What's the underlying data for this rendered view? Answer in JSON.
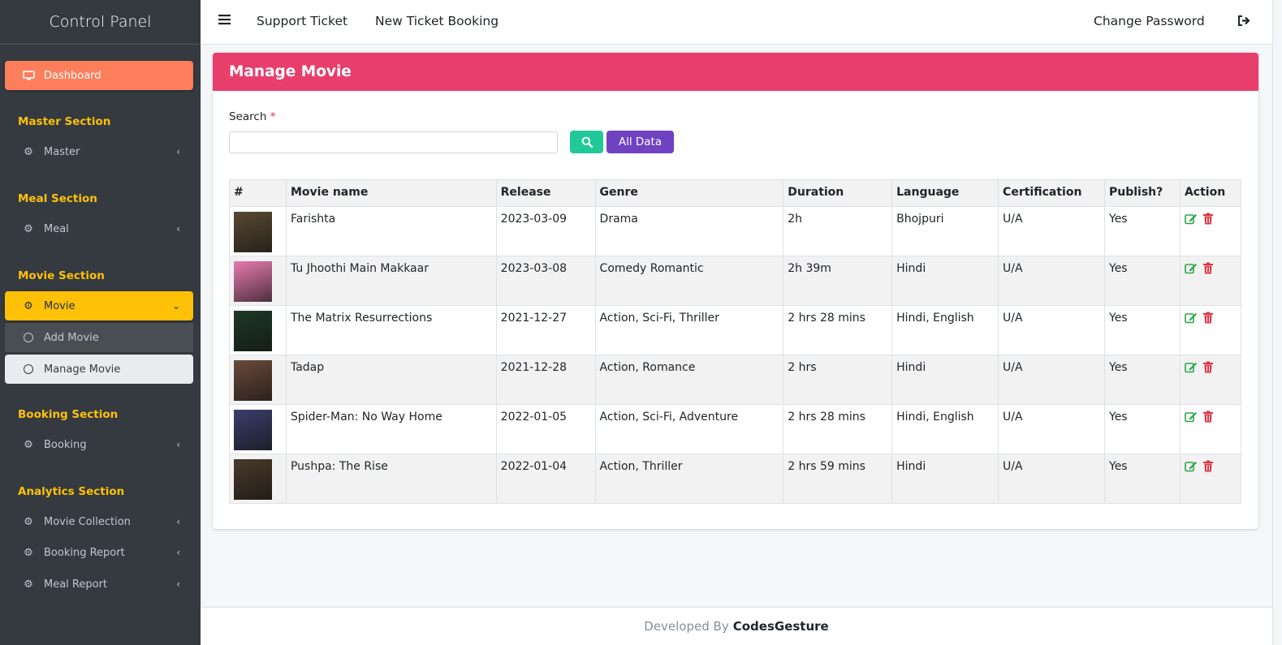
{
  "brand": "Control Panel",
  "sidebar": {
    "dashboard": "Dashboard",
    "sections": {
      "master": {
        "title": "Master Section",
        "item": "Master"
      },
      "meal": {
        "title": "Meal Section",
        "item": "Meal"
      },
      "movie": {
        "title": "Movie Section",
        "item": "Movie",
        "sub": [
          "Add Movie",
          "Manage Movie"
        ]
      },
      "booking": {
        "title": "Booking Section",
        "item": "Booking"
      },
      "analytics": {
        "title": "Analytics Section",
        "items": [
          "Movie Collection",
          "Booking Report",
          "Meal Report"
        ]
      }
    }
  },
  "topbar": {
    "support": "Support Ticket",
    "new_booking": "New Ticket Booking",
    "change_password": "Change Password"
  },
  "card": {
    "title": "Manage Movie",
    "search_label": "Search",
    "required_mark": "*",
    "search_value": "",
    "all_data_label": "All Data"
  },
  "table": {
    "headers": [
      "#",
      "Movie name",
      "Release",
      "Genre",
      "Duration",
      "Language",
      "Certification",
      "Publish?",
      "Action"
    ],
    "rows": [
      {
        "name": "Farishta",
        "release": "2023-03-09",
        "genre": "Drama",
        "duration": "2h",
        "language": "Bhojpuri",
        "cert": "U/A",
        "publish": "Yes",
        "poster_color": "#5a4a32"
      },
      {
        "name": "Tu Jhoothi Main Makkaar",
        "release": "2023-03-08",
        "genre": "Comedy Romantic",
        "duration": "2h 39m",
        "language": "Hindi",
        "cert": "U/A",
        "publish": "Yes",
        "poster_color": "#e87bb0"
      },
      {
        "name": "The Matrix Resurrections",
        "release": "2021-12-27",
        "genre": "Action, Sci-Fi, Thriller",
        "duration": "2 hrs 28 mins",
        "language": "Hindi, English",
        "cert": "U/A",
        "publish": "Yes",
        "poster_color": "#1e3a24"
      },
      {
        "name": "Tadap",
        "release": "2021-12-28",
        "genre": "Action, Romance",
        "duration": "2 hrs",
        "language": "Hindi",
        "cert": "U/A",
        "publish": "Yes",
        "poster_color": "#6b4a3a"
      },
      {
        "name": "Spider-Man: No Way Home",
        "release": "2022-01-05",
        "genre": "Action, Sci-Fi, Adventure",
        "duration": "2 hrs 28 mins",
        "language": "Hindi, English",
        "cert": "U/A",
        "publish": "Yes",
        "poster_color": "#3a3f6b"
      },
      {
        "name": "Pushpa: The Rise",
        "release": "2022-01-04",
        "genre": "Action, Thriller",
        "duration": "2 hrs 59 mins",
        "language": "Hindi",
        "cert": "U/A",
        "publish": "Yes",
        "poster_color": "#4a3a2a"
      }
    ]
  },
  "footer": {
    "prefix": "Developed By",
    "brand": "CodesGesture"
  },
  "colors": {
    "sidebar": "#343a40",
    "section_head": "#ffc107",
    "dashboard": "#fd7e5b",
    "header": "#e83e6c",
    "search_btn": "#20c997",
    "all_btn": "#6f42c1",
    "edit": "#28a745",
    "delete": "#dc3545"
  }
}
